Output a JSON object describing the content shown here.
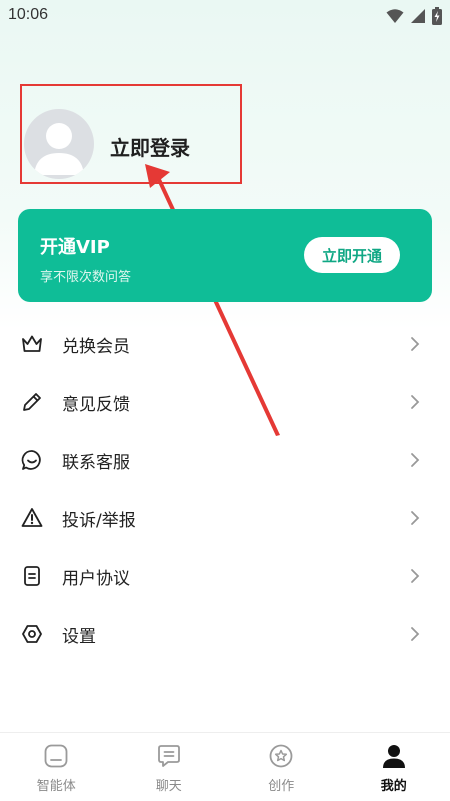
{
  "status_bar": {
    "time": "10:06"
  },
  "profile": {
    "login_label": "立即登录"
  },
  "vip": {
    "title": "开通VIP",
    "subtitle": "享不限次数问答",
    "button_label": "立即开通",
    "color": "#0fbd97"
  },
  "menu": {
    "items": [
      {
        "label": "兑换会员",
        "icon": "crown-icon"
      },
      {
        "label": "意见反馈",
        "icon": "pencil-icon"
      },
      {
        "label": "联系客服",
        "icon": "chat-smile-icon"
      },
      {
        "label": "投诉/举报",
        "icon": "warning-icon"
      },
      {
        "label": "用户协议",
        "icon": "document-icon"
      },
      {
        "label": "设置",
        "icon": "settings-hexagon-icon"
      }
    ]
  },
  "bottom_nav": {
    "items": [
      {
        "label": "智能体",
        "icon": "agent-icon",
        "active": false
      },
      {
        "label": "聊天",
        "icon": "chat-icon",
        "active": false
      },
      {
        "label": "创作",
        "icon": "create-icon",
        "active": false
      },
      {
        "label": "我的",
        "icon": "person-icon",
        "active": true
      }
    ]
  },
  "annotation": {
    "color": "#e53935"
  }
}
